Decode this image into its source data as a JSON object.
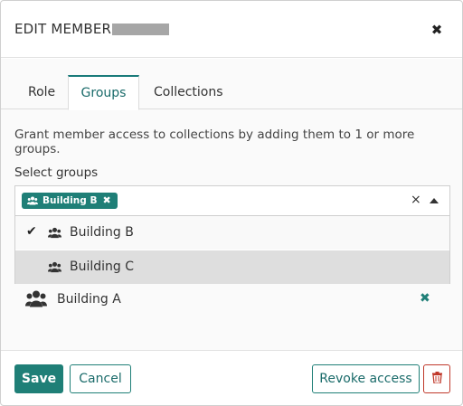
{
  "modal": {
    "title": "EDIT MEMBER",
    "close_icon": "close-icon"
  },
  "tabs": [
    {
      "label": "Role",
      "active": false
    },
    {
      "label": "Groups",
      "active": true
    },
    {
      "label": "Collections",
      "active": false
    }
  ],
  "description": "Grant member access to collections by adding them to 1 or more groups.",
  "select": {
    "label": "Select groups",
    "selected_chips": [
      {
        "label": "Building B",
        "icon": "users-icon"
      }
    ],
    "clear_icon": "clear-icon",
    "caret_icon": "caret-up-icon",
    "options": [
      {
        "label": "Building B",
        "selected": true,
        "icon": "users-icon"
      },
      {
        "label": "Building C",
        "selected": false,
        "highlighted": true,
        "icon": "users-icon"
      }
    ]
  },
  "assigned_groups": [
    {
      "label": "Building A",
      "icon": "users-icon",
      "remove_icon": "remove-icon"
    }
  ],
  "footer": {
    "save_label": "Save",
    "cancel_label": "Cancel",
    "revoke_label": "Revoke access",
    "delete_icon": "trash-icon"
  },
  "colors": {
    "accent": "#1f7f77",
    "danger": "#c0392b",
    "highlight": "#dedede"
  }
}
